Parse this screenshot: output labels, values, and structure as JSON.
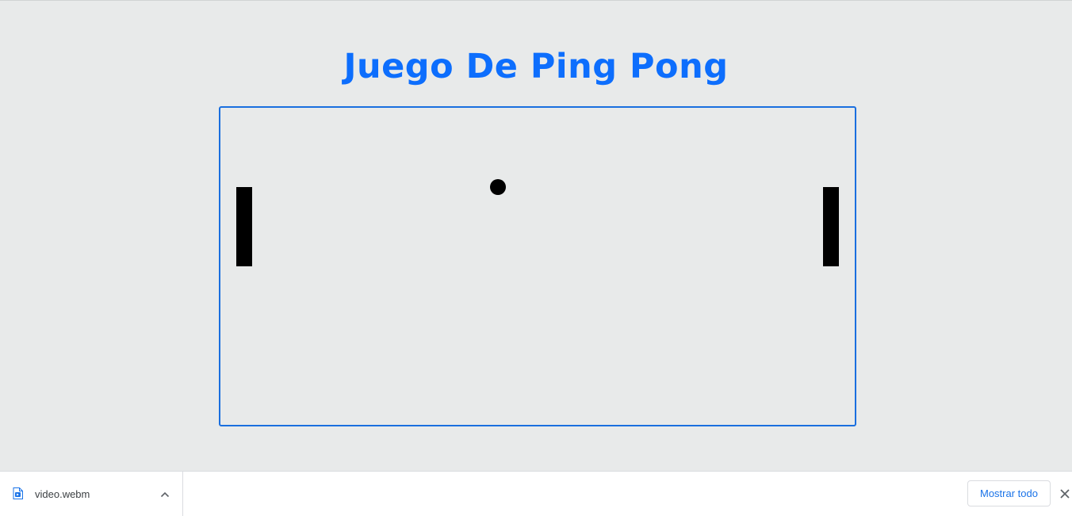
{
  "page": {
    "title": "Juego De Ping Pong",
    "accent_color": "#0d6efd"
  },
  "game": {
    "border_color": "#1a6fdf",
    "paddle_color": "#000000",
    "ball_color": "#000000"
  },
  "download_shelf": {
    "file_name": "video.webm",
    "file_icon": "video-file-icon",
    "expand_icon": "chevron-up-icon",
    "show_all_label": "Mostrar todo",
    "close_icon": "close-icon"
  }
}
